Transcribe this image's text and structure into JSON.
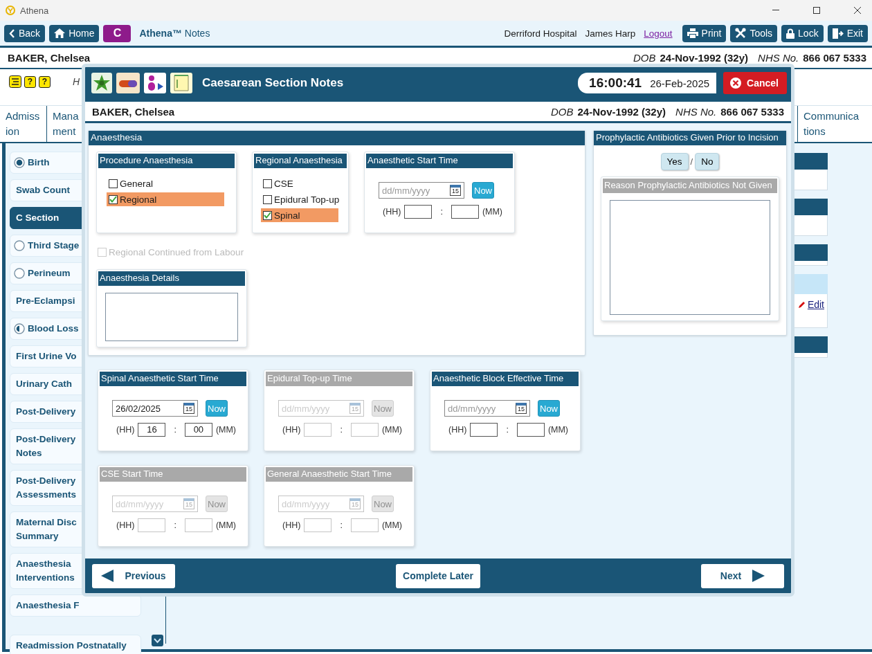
{
  "window": {
    "title": "Athena"
  },
  "toolbar": {
    "left_buttons": [
      {
        "kind": "back",
        "label": "Back"
      },
      {
        "kind": "home",
        "label": "Home"
      },
      {
        "kind": "badge",
        "label": "C"
      }
    ],
    "app_name": "Athena™",
    "app_section": "Notes",
    "location": "Derriford Hospital",
    "user": "James Harp",
    "logout": "Logout",
    "right_buttons": [
      {
        "kind": "print",
        "label": "Print"
      },
      {
        "kind": "tools",
        "label": "Tools"
      },
      {
        "kind": "lock",
        "label": "Lock"
      },
      {
        "kind": "exit",
        "label": "Exit"
      }
    ]
  },
  "patient": {
    "name": "BAKER, Chelsea",
    "dob_label": "DOB",
    "dob": "24-Nov-1992 (32y)",
    "nhs_label": "NHS No.",
    "nhs": "866 067 5333"
  },
  "help_icons": [
    {
      "kind": "list"
    },
    {
      "kind": "help",
      "glyph": "?"
    },
    {
      "kind": "help",
      "glyph": "?"
    }
  ],
  "info_text": "H",
  "tabs_left": [
    {
      "lines": [
        "Admiss",
        "ion"
      ],
      "selected": false
    },
    {
      "lines": [
        "Mana",
        "ment"
      ],
      "selected": false
    }
  ],
  "tabs_right": [
    {
      "lines": [
        "Communica",
        "tions"
      ],
      "selected": false
    }
  ],
  "sidebar": {
    "items": [
      {
        "lines": [
          "Birth"
        ],
        "kind": "complete",
        "selected": false
      },
      {
        "lines": [
          "Swab Count"
        ],
        "selected": false
      },
      {
        "lines": [
          "C Section"
        ],
        "selected": true
      },
      {
        "lines": [
          "Third Stage"
        ],
        "kind": "empty",
        "selected": false
      },
      {
        "lines": [
          "Perineum"
        ],
        "kind": "empty",
        "selected": false
      },
      {
        "lines": [
          "Pre-Eclampsi"
        ],
        "selected": false
      },
      {
        "lines": [
          "Blood Loss"
        ],
        "kind": "partial",
        "selected": false
      },
      {
        "lines": [
          "First Urine Vo"
        ],
        "selected": false
      },
      {
        "lines": [
          "Urinary Cath"
        ],
        "selected": false
      },
      {
        "lines": [
          "Post-Delivery"
        ],
        "selected": false
      },
      {
        "lines": [
          "Post-Delivery",
          "Notes"
        ],
        "selected": false
      },
      {
        "lines": [
          "Post-Delivery",
          "Assessments"
        ],
        "selected": false
      },
      {
        "lines": [
          "Maternal Disc",
          "Summary"
        ],
        "selected": false
      },
      {
        "lines": [
          "Anaesthesia",
          "Interventions"
        ],
        "selected": false
      },
      {
        "lines": [
          "Anaesthesia F"
        ],
        "selected": false
      },
      {
        "lines": [
          "Readmission Postnatally"
        ],
        "selected": false
      }
    ]
  },
  "background_edit_link": "Edit",
  "modal": {
    "title": "Caesarean Section Notes",
    "time": "16:00:41",
    "date": "26-Feb-2025",
    "cancel": "Cancel",
    "patient": {
      "name": "BAKER, Chelsea",
      "dob_label": "DOB",
      "dob": "24-Nov-1992 (32y)",
      "nhs_label": "NHS No.",
      "nhs": "866 067 5333"
    },
    "anaesthesia": {
      "title": "Anaesthesia",
      "procedure": {
        "title": "Procedure Anaesthesia",
        "options": [
          {
            "label": "General",
            "checked": false
          },
          {
            "label": "Regional",
            "checked": true
          }
        ]
      },
      "regional": {
        "title": "Regional Anaesthesia",
        "options": [
          {
            "label": "CSE",
            "checked": false
          },
          {
            "label": "Epidural Top-up",
            "checked": false
          },
          {
            "label": "Spinal",
            "checked": true
          }
        ]
      },
      "start_time": {
        "title": "Anaesthetic Start Time",
        "enabled": true,
        "date_placeholder": "dd/mm/yyyy",
        "calendar_day": "15",
        "now": "Now",
        "hh_label": "(HH)",
        "separator": ":",
        "mm_label": "(MM)"
      },
      "continued": {
        "label": "Regional Continued from Labour",
        "checked": false,
        "disabled": true
      },
      "details": {
        "title": "Anaesthesia Details"
      }
    },
    "antibiotics": {
      "title": "Prophylactic Antibiotics Given Prior to Incision",
      "options": [
        {
          "label": "Yes",
          "selected": false
        },
        {
          "label": "No",
          "selected": false
        }
      ],
      "separator": "/",
      "reason": {
        "title": "Reason Prophylactic Antibiotics Not Given",
        "disabled": true
      }
    },
    "time_panels": [
      {
        "title": "Spinal Anaesthetic Start Time",
        "enabled": true,
        "date_value": "26/02/2025",
        "calendar_day": "15",
        "now": "Now",
        "hh_label": "(HH)",
        "hh": "16",
        "separator": ":",
        "mm": "00",
        "mm_label": "(MM)"
      },
      {
        "title": "Epidural Top-up Time",
        "enabled": false,
        "date_placeholder": "dd/mm/yyyy",
        "calendar_day": "15",
        "now": "Now",
        "hh_label": "(HH)",
        "separator": ":",
        "mm_label": "(MM)"
      },
      {
        "title": "Anaesthetic Block Effective Time",
        "enabled": true,
        "date_placeholder": "dd/mm/yyyy",
        "calendar_day": "15",
        "now": "Now",
        "hh_label": "(HH)",
        "separator": ":",
        "mm_label": "(MM)"
      },
      {
        "title": "CSE Start Time",
        "enabled": false,
        "date_placeholder": "dd/mm/yyyy",
        "calendar_day": "15",
        "now": "Now",
        "hh_label": "(HH)",
        "separator": ":",
        "mm_label": "(MM)"
      },
      {
        "title": "General Anaesthetic Start Time",
        "enabled": false,
        "date_placeholder": "dd/mm/yyyy",
        "calendar_day": "15",
        "now": "Now",
        "hh_label": "(HH)",
        "separator": ":",
        "mm_label": "(MM)"
      }
    ],
    "footer": {
      "previous": "Previous",
      "complete_later": "Complete Later",
      "next": "Next"
    }
  }
}
